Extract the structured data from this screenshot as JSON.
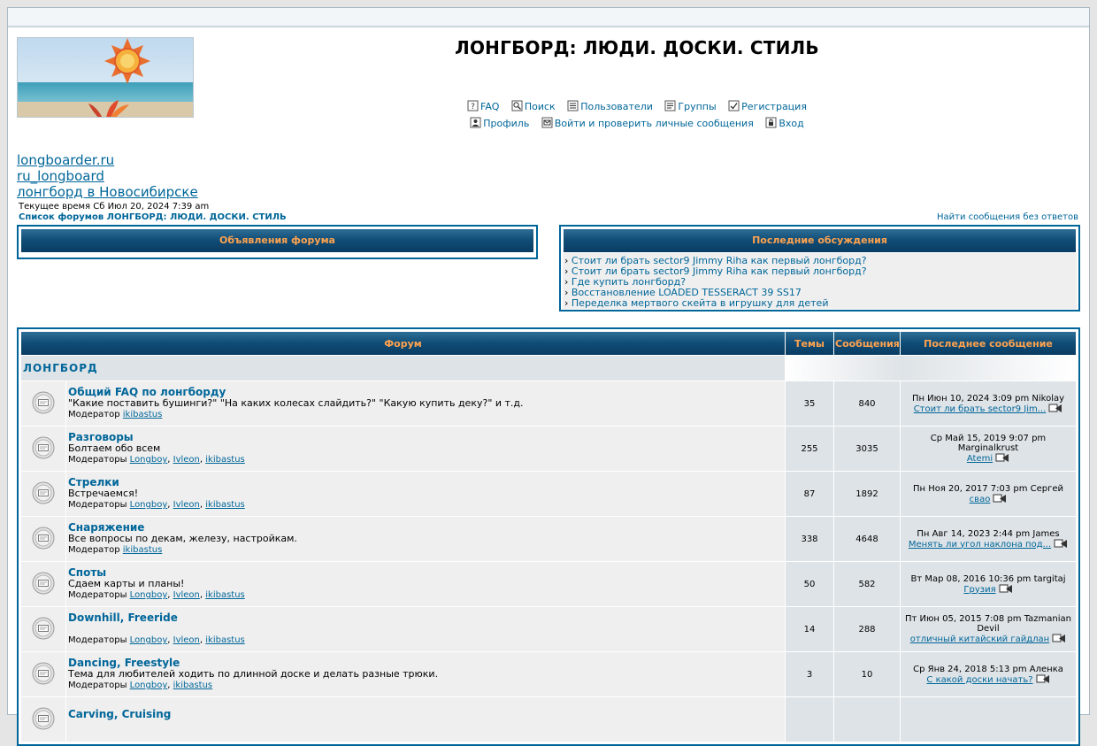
{
  "site": {
    "title": "ЛОНГБОРД: ЛЮДИ. ДОСКИ. СТИЛЬ"
  },
  "nav": {
    "row1": [
      {
        "label": "FAQ",
        "icon": "faq-icon"
      },
      {
        "label": "Поиск",
        "icon": "search-icon"
      },
      {
        "label": "Пользователи",
        "icon": "members-icon"
      },
      {
        "label": "Группы",
        "icon": "groups-icon"
      },
      {
        "label": "Регистрация",
        "icon": "register-icon"
      }
    ],
    "row2": [
      {
        "label": "Профиль",
        "icon": "profile-icon"
      },
      {
        "label": "Войти и проверить личные сообщения",
        "icon": "messages-icon"
      },
      {
        "label": "Вход",
        "icon": "login-icon"
      }
    ]
  },
  "links": [
    "longboarder.ru",
    "ru_longboard",
    "лонгборд в Новосибирске"
  ],
  "current_time": "Текущее время Сб Июл 20, 2024 7:39 am",
  "breadcrumb": "Список форумов ЛОНГБОРД: ЛЮДИ. ДОСКИ. СТИЛЬ",
  "unanswered_link": "Найти сообщения без ответов",
  "announcements": {
    "title": "Объявления форума"
  },
  "recent": {
    "title": "Последние обсуждения",
    "bullet": "›",
    "items": [
      "Стоит ли брать sector9 Jimmy Riha как первый лонгборд?",
      "Стоит ли брать sector9 Jimmy Riha как первый лонгборд?",
      "Где купить лонгборд?",
      "Восстановление LOADED TESSERACT 39 SS17",
      "Переделка мертвого скейта в игрушку для детей"
    ]
  },
  "table": {
    "headers": {
      "forum": "Форум",
      "topics": "Темы",
      "posts": "Сообщения",
      "last_post": "Последнее сообщение"
    },
    "category": "ЛОНГБОРД",
    "forums": [
      {
        "name": "Общий FAQ по лонгборду",
        "desc": "\"Какие поставить бушинги?\" \"На каких колесах слайдить?\" \"Какую купить деку?\" и т.д.",
        "mod_label": "Модератор",
        "mods": [
          "ikibastus"
        ],
        "topics": "35",
        "posts": "840",
        "last_date": "Пн Июн 10, 2024 3:09 pm Nikolay",
        "last_topic": "Стоит ли брать sector9 Jim..."
      },
      {
        "name": "Разговоры",
        "desc": "Болтаем обо всем",
        "mod_label": "Модераторы",
        "mods": [
          "Longboy",
          "Ivleon",
          "ikibastus"
        ],
        "topics": "255",
        "posts": "3035",
        "last_date": "Ср Май 15, 2019 9:07 pm Marginalkrust",
        "last_topic": "Atemi"
      },
      {
        "name": "Стрелки",
        "desc": "Встречаемся!",
        "mod_label": "Модераторы",
        "mods": [
          "Longboy",
          "Ivleon",
          "ikibastus"
        ],
        "topics": "87",
        "posts": "1892",
        "last_date": "Пн Ноя 20, 2017 7:03 pm Сергей",
        "last_topic": "свао"
      },
      {
        "name": "Снаряжение",
        "desc": "Все вопросы по декам, железу, настройкам.",
        "mod_label": "Модератор",
        "mods": [
          "ikibastus"
        ],
        "topics": "338",
        "posts": "4648",
        "last_date": "Пн Авг 14, 2023 2:44 pm James",
        "last_topic": "Менять ли угол наклона под..."
      },
      {
        "name": "Споты",
        "desc": "Сдаем карты и планы!",
        "mod_label": "Модераторы",
        "mods": [
          "Longboy",
          "Ivleon",
          "ikibastus"
        ],
        "topics": "50",
        "posts": "582",
        "last_date": "Вт Мар 08, 2016 10:36 pm targitaj",
        "last_topic": "Грузия"
      },
      {
        "name": "Downhill, Freeride",
        "desc": "",
        "mod_label": "Модераторы",
        "mods": [
          "Longboy",
          "Ivleon",
          "ikibastus"
        ],
        "topics": "14",
        "posts": "288",
        "last_date": "Пт Июн 05, 2015 7:08 pm Tazmanian Devil",
        "last_topic": "отличный китайский гайдлан"
      },
      {
        "name": "Dancing, Freestyle",
        "desc": "Тема для любителей ходить по длинной доске и делать разные трюки.",
        "mod_label": "Модераторы",
        "mods": [
          "Longboy",
          "ikibastus"
        ],
        "topics": "3",
        "posts": "10",
        "last_date": "Ср Янв 24, 2018 5:13 pm Аленка",
        "last_topic": "С какой доски начать?"
      },
      {
        "name": "Carving, Cruising",
        "desc": "",
        "mod_label": "",
        "mods": [],
        "topics": "",
        "posts": "",
        "last_date": "",
        "last_topic": ""
      }
    ]
  },
  "colors": {
    "link": "#006699",
    "header_text": "#FFA34F",
    "header_bg": "#0F4C75",
    "row_light": "#EFEFEF",
    "row_dark": "#DEE3E7"
  }
}
